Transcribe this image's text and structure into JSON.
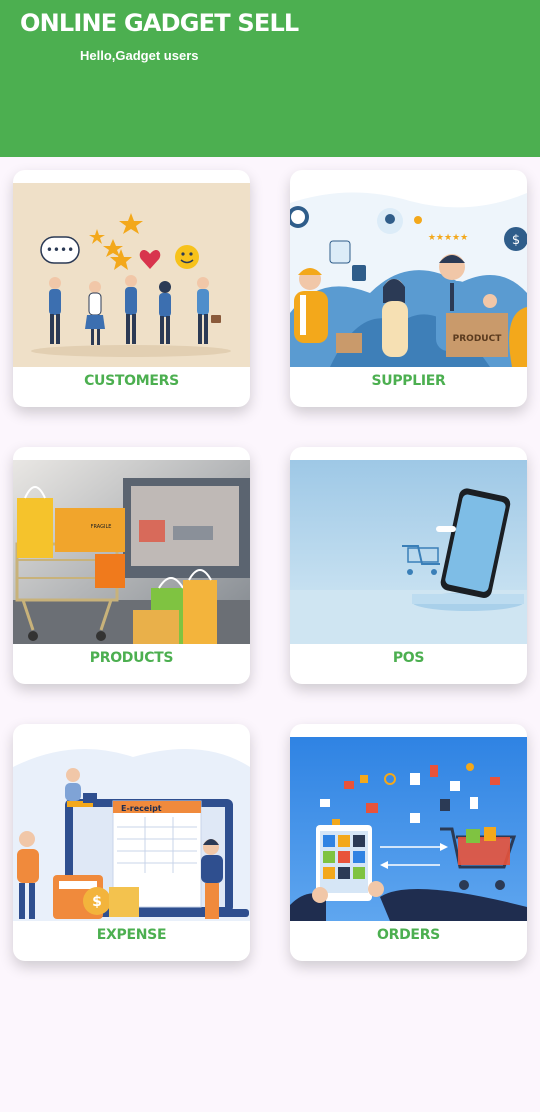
{
  "header": {
    "title": "ONLINE GADGET SELL",
    "subtitle": "Hello,Gadget users",
    "background_color": "#4caf50"
  },
  "menu": {
    "accent_color": "#4caf50",
    "cards": [
      {
        "label": "CUSTOMERS",
        "illustration": "customers-illustration"
      },
      {
        "label": "SUPPLIER",
        "illustration": "supplier-illustration"
      },
      {
        "label": "PRODUCTS",
        "illustration": "products-illustration"
      },
      {
        "label": "POS",
        "illustration": "pos-illustration"
      },
      {
        "label": "EXPENSE",
        "illustration": "expense-illustration"
      },
      {
        "label": "ORDERS",
        "illustration": "orders-illustration"
      }
    ]
  },
  "illustrations": {
    "supplier_box_text": "PRODUCT",
    "expense_receipt_title": "E-receipt",
    "products_box_text": "FRAGILE"
  }
}
